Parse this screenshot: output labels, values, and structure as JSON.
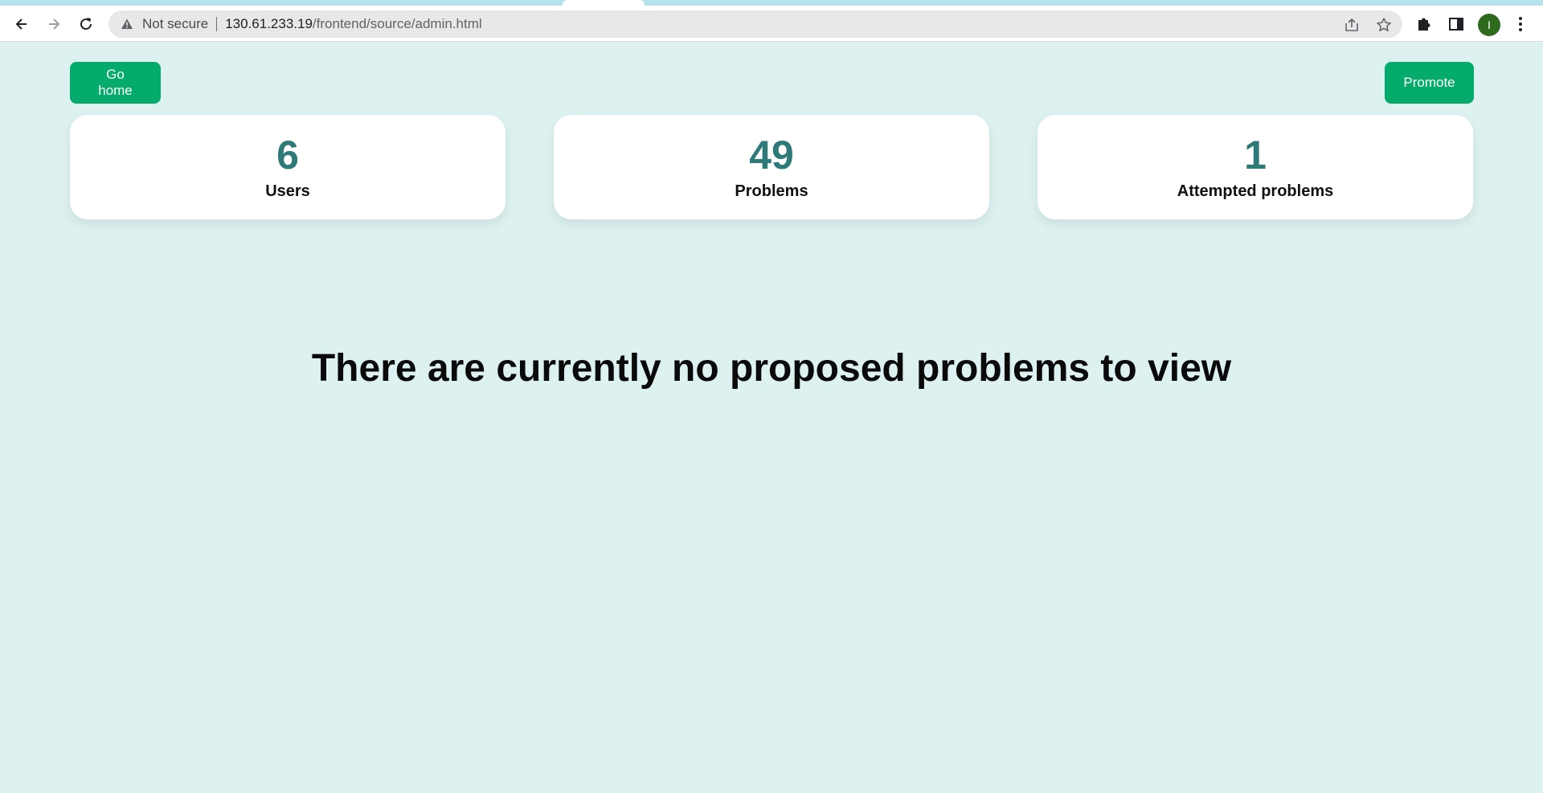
{
  "browser": {
    "security_label": "Not secure",
    "url_host": "130.61.233.19",
    "url_path": "/frontend/source/admin.html",
    "avatar_letter": "I",
    "icons": {
      "back": "arrow-left-icon",
      "forward": "arrow-right-icon",
      "reload": "reload-icon",
      "warning": "warning-triangle-icon",
      "share": "share-icon",
      "bookmark": "star-icon",
      "extensions": "puzzle-icon",
      "side_panel": "side-panel-icon",
      "menu": "kebab-menu-icon"
    }
  },
  "header": {
    "home_label": "Go home",
    "promote_label": "Promote"
  },
  "stats": [
    {
      "value": "6",
      "label": "Users"
    },
    {
      "value": "49",
      "label": "Problems"
    },
    {
      "value": "1",
      "label": "Attempted problems"
    }
  ],
  "main": {
    "empty_message": "There are currently no proposed problems to view"
  },
  "colors": {
    "accent": "#04ab6a",
    "stat_value": "#2e7a78",
    "page_bg": "#ddf1f1"
  }
}
